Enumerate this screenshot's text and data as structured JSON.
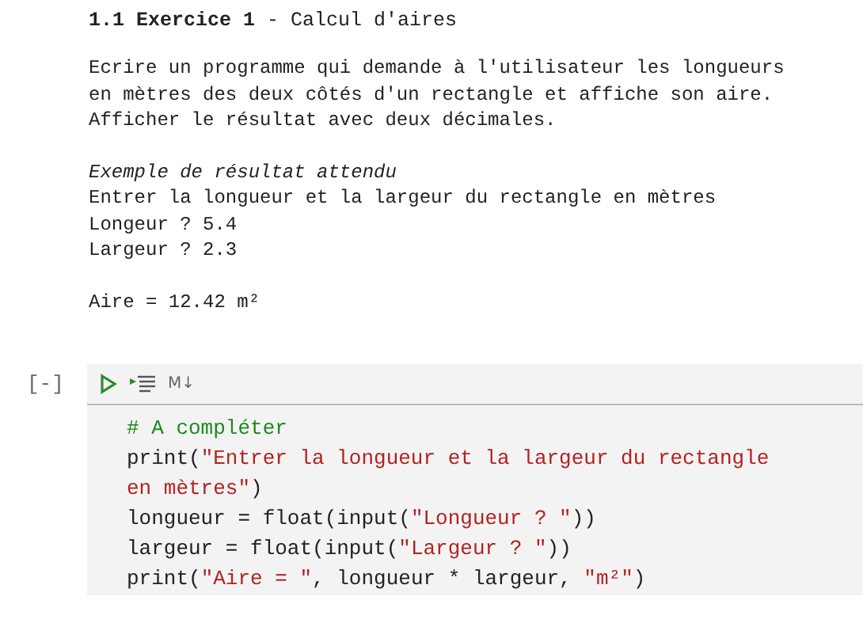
{
  "text_cell": {
    "heading": {
      "number": "1.1",
      "title": "Exercice 1",
      "subtitle": "- Calcul d'aires"
    },
    "paragraph": [
      "Ecrire un programme qui demande à l'utilisateur les longueurs",
      "en mètres des deux côtés d'un rectangle et affiche son aire.",
      "Afficher le résultat avec deux décimales."
    ],
    "example_title": "Exemple de résultat attendu",
    "example_lines": [
      "Entrer la longueur et la largeur du rectangle en mètres",
      "Longeur ? 5.4",
      "Largeur ? 2.3"
    ],
    "example_result": "Aire = 12.42 m²"
  },
  "code_cell": {
    "prompt": "[-]",
    "toolbar": {
      "markdown_label": "M↓"
    },
    "lines": [
      [
        {
          "kind": "comment",
          "text": "# A compléter"
        }
      ],
      [
        {
          "kind": "plain",
          "text": "print("
        },
        {
          "kind": "string",
          "text": "\"Entrer la longueur et la largeur du rectangle"
        }
      ],
      [
        {
          "kind": "string",
          "text": "en mètres\""
        },
        {
          "kind": "plain",
          "text": ")"
        }
      ],
      [
        {
          "kind": "plain",
          "text": "longueur = float(input("
        },
        {
          "kind": "string",
          "text": "\"Longueur ? \""
        },
        {
          "kind": "plain",
          "text": "))"
        }
      ],
      [
        {
          "kind": "plain",
          "text": "largeur = float(input("
        },
        {
          "kind": "string",
          "text": "\"Largeur ? \""
        },
        {
          "kind": "plain",
          "text": "))"
        }
      ],
      [
        {
          "kind": "plain",
          "text": "print("
        },
        {
          "kind": "string",
          "text": "\"Aire = \""
        },
        {
          "kind": "plain",
          "text": ", longueur * largeur, "
        },
        {
          "kind": "string",
          "text": "\"m²\""
        },
        {
          "kind": "plain",
          "text": ")"
        }
      ]
    ]
  }
}
